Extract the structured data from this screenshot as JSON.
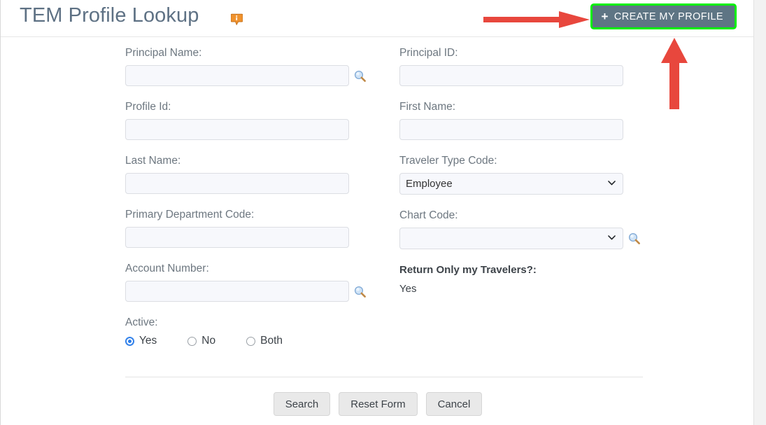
{
  "header": {
    "title": "TEM Profile Lookup",
    "help_icon": "info-bubble-icon",
    "create_button": {
      "label": "CREATE MY PROFILE",
      "plus_glyph": "+",
      "background_color": "#5e7584",
      "text_color": "#ffffff",
      "highlight_color": "#00ef00"
    }
  },
  "annotations": {
    "arrow_color": "#e8473d",
    "horizontal_arrow": "points-right-at-create-my-profile-button",
    "vertical_arrow": "points-up-at-create-my-profile-button"
  },
  "form": {
    "left_column": [
      {
        "label": "Principal Name:",
        "type": "text",
        "value": "",
        "placeholder": "",
        "has_lookup": true
      },
      {
        "label": "Profile Id:",
        "type": "text",
        "value": "",
        "placeholder": "",
        "has_lookup": false
      },
      {
        "label": "Last Name:",
        "type": "text",
        "value": "",
        "placeholder": "",
        "has_lookup": false
      },
      {
        "label": "Primary Department Code:",
        "type": "text",
        "value": "",
        "placeholder": "",
        "has_lookup": false
      },
      {
        "label": "Account Number:",
        "type": "text",
        "value": "",
        "placeholder": "",
        "has_lookup": true
      }
    ],
    "right_column": [
      {
        "label": "Principal ID:",
        "type": "text",
        "value": "",
        "placeholder": "",
        "has_lookup": false
      },
      {
        "label": "First Name:",
        "type": "text",
        "value": "",
        "placeholder": "",
        "has_lookup": false
      },
      {
        "label": "Traveler Type Code:",
        "type": "select",
        "value": "Employee",
        "options": [
          "Employee"
        ],
        "has_lookup": false
      },
      {
        "label": "Chart Code:",
        "type": "select",
        "value": "",
        "options": [
          ""
        ],
        "has_lookup": true
      }
    ],
    "active": {
      "label": "Active:",
      "selected": "Yes",
      "options": [
        "Yes",
        "No",
        "Both"
      ]
    },
    "return_only_my_travelers": {
      "label": "Return Only my Travelers?:",
      "value": "Yes"
    }
  },
  "footer": {
    "buttons": [
      {
        "label": "Search"
      },
      {
        "label": "Reset Form"
      },
      {
        "label": "Cancel"
      }
    ]
  },
  "icons": {
    "lookup": "magnifying-glass-icon",
    "chevron": "chevron-down-icon"
  }
}
